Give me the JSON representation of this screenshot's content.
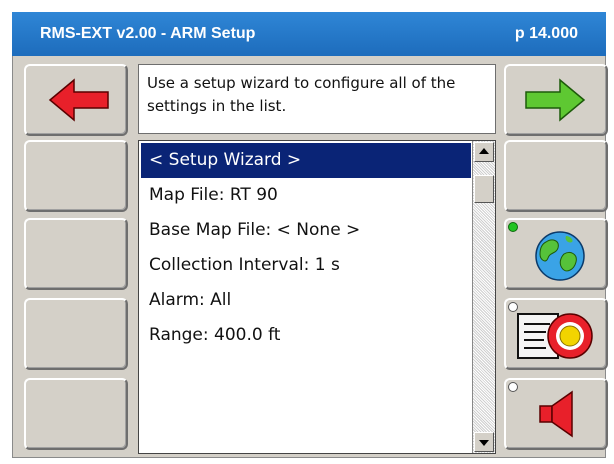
{
  "window": {
    "title": "RMS-EXT v2.00 - ARM Setup",
    "page": "p 14.000"
  },
  "description": "Use a setup wizard to configure all of the settings in the list.",
  "list": {
    "selected_index": 0,
    "items": [
      "< Setup Wizard >",
      "Map File: RT 90",
      "Base Map File: < None >",
      "Collection Interval: 1 s",
      "Alarm: All",
      "Range: 400.0 ft"
    ]
  },
  "nav": {
    "back_icon": "red-left-arrow-icon",
    "forward_icon": "green-right-arrow-icon"
  },
  "side_buttons": [
    {
      "icon": "globe-icon",
      "indicator": "green"
    },
    {
      "icon": "target-document-icon",
      "indicator": "off"
    },
    {
      "icon": "speaker-icon",
      "indicator": "off"
    }
  ],
  "colors": {
    "title_bar": "#1d6cbc",
    "selection": "#0a2476",
    "back_arrow": "#e8202a",
    "forward_arrow": "#5ec832",
    "indicator_on": "#22c422"
  }
}
